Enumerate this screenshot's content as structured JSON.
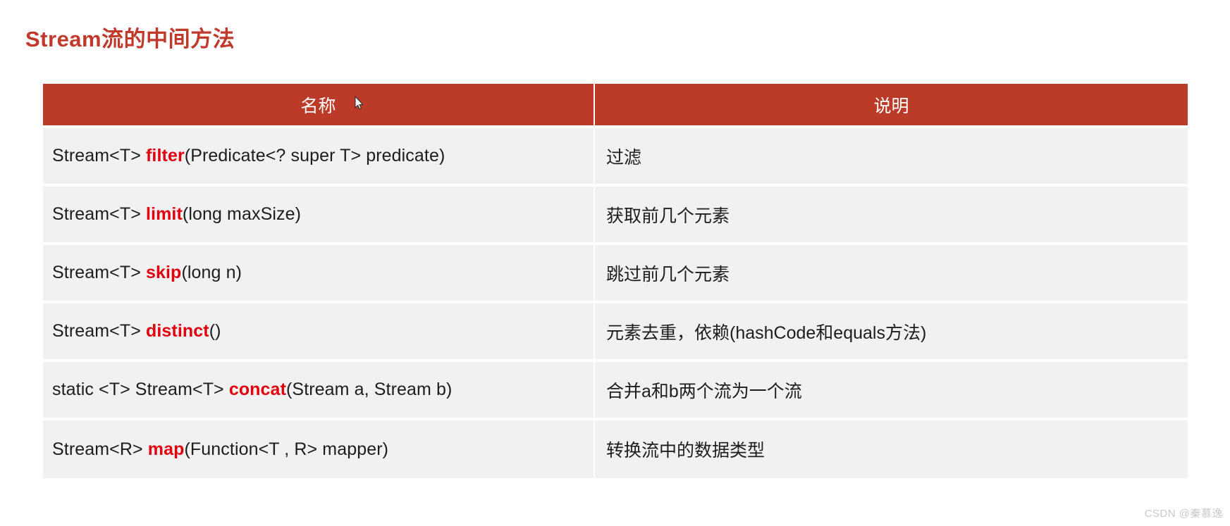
{
  "title": "Stream流的中间方法",
  "accent_color": "#BB3A28",
  "keyword_color": "#E2000F",
  "table": {
    "headers": {
      "name": "名称",
      "desc": "说明"
    },
    "rows": [
      {
        "name_prefix": "Stream<T> ",
        "name_keyword": "filter",
        "name_suffix": "(Predicate<? super T> predicate)",
        "desc": "过滤"
      },
      {
        "name_prefix": "Stream<T> ",
        "name_keyword": "limit",
        "name_suffix": "(long maxSize)",
        "desc": "获取前几个元素"
      },
      {
        "name_prefix": "Stream<T> ",
        "name_keyword": "skip",
        "name_suffix": "(long n)",
        "desc": "跳过前几个元素"
      },
      {
        "name_prefix": "Stream<T> ",
        "name_keyword": "distinct",
        "name_suffix": "()",
        "desc": "元素去重，依赖(hashCode和equals方法)"
      },
      {
        "name_prefix": "static <T> Stream<T> ",
        "name_keyword": "concat",
        "name_suffix": "(Stream a, Stream b)",
        "desc": "合并a和b两个流为一个流"
      },
      {
        "name_prefix": "Stream<R> ",
        "name_keyword": "map",
        "name_suffix": "(Function<T , R>  mapper)",
        "desc": "转换流中的数据类型"
      }
    ]
  },
  "watermark": "CSDN @秦慕逸"
}
